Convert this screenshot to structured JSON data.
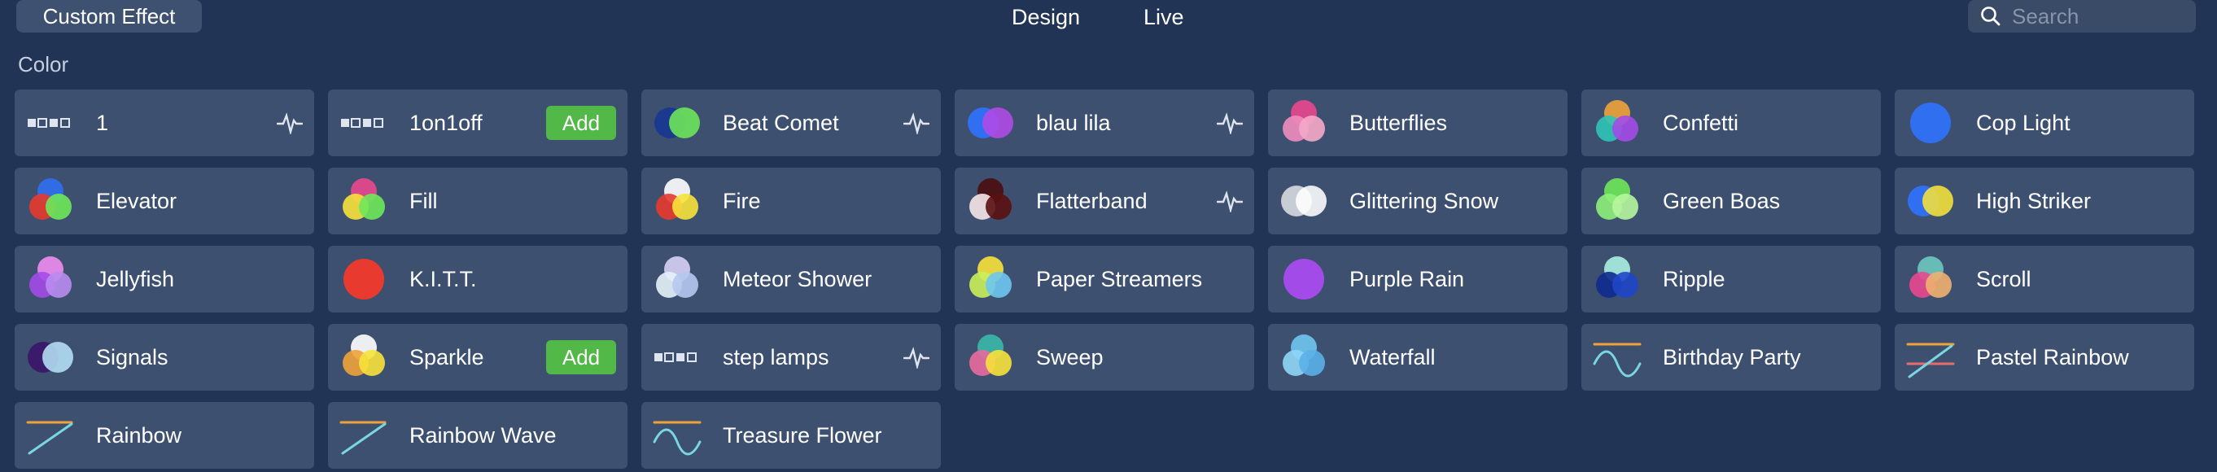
{
  "header": {
    "custom_effect_label": "Custom Effect",
    "tabs": [
      {
        "label": "Design"
      },
      {
        "label": "Live"
      }
    ],
    "search_placeholder": "Search"
  },
  "section_title": "Color",
  "effects": [
    {
      "label": "1",
      "icon": "squares-icon",
      "action": "pulse"
    },
    {
      "label": "1on1off",
      "icon": "squares-icon",
      "action": "add",
      "action_label": "Add"
    },
    {
      "label": "Beat Comet",
      "icon": "two-circles-icon",
      "colors": [
        "#1b3a8f",
        "#6ee85a"
      ],
      "action": "pulse"
    },
    {
      "label": "blau lila",
      "icon": "two-circles-icon",
      "colors": [
        "#2f6ff0",
        "#b44ae8"
      ],
      "action": "pulse"
    },
    {
      "label": "Butterflies",
      "icon": "three-circles-icon",
      "colors": [
        "#e8488e",
        "#f08cbd",
        "#f5a8c8"
      ]
    },
    {
      "label": "Confetti",
      "icon": "three-circles-icon",
      "colors": [
        "#f0a23a",
        "#2ec4b6",
        "#a34be8"
      ]
    },
    {
      "label": "Cop Light",
      "icon": "single-circle-icon",
      "colors": [
        "#2f6ff0"
      ]
    },
    {
      "label": "Elevator",
      "icon": "three-circles-icon",
      "colors": [
        "#2f6ff0",
        "#e83a2e",
        "#6ee85a"
      ]
    },
    {
      "label": "Fill",
      "icon": "three-circles-icon",
      "colors": [
        "#e8488e",
        "#f7e23a",
        "#6ee85a"
      ]
    },
    {
      "label": "Fire",
      "icon": "three-circles-icon",
      "colors": [
        "#ffffff",
        "#e83a2e",
        "#f7e23a"
      ]
    },
    {
      "label": "Flatterband",
      "icon": "three-circles-icon",
      "colors": [
        "#4a0d0d",
        "#f5e6e8",
        "#5a1010"
      ],
      "action": "pulse"
    },
    {
      "label": "Glittering Snow",
      "icon": "two-circles-icon",
      "colors": [
        "#c8ccd4",
        "#ffffff"
      ]
    },
    {
      "label": "Green Boas",
      "icon": "three-circles-icon",
      "colors": [
        "#6ee85a",
        "#8ef07a",
        "#b6f59e"
      ]
    },
    {
      "label": "High Striker",
      "icon": "two-circles-icon",
      "colors": [
        "#2f6ff0",
        "#f7e23a"
      ]
    },
    {
      "label": "Jellyfish",
      "icon": "three-circles-icon",
      "colors": [
        "#f08cf0",
        "#a34be8",
        "#b98cf0"
      ]
    },
    {
      "label": "K.I.T.T.",
      "icon": "single-circle-icon",
      "colors": [
        "#e83a2e"
      ]
    },
    {
      "label": "Meteor Shower",
      "icon": "three-circles-icon",
      "colors": [
        "#d6d0f5",
        "#e6f2fa",
        "#b6c8f0"
      ]
    },
    {
      "label": "Paper Streamers",
      "icon": "three-circles-icon",
      "colors": [
        "#f7e23a",
        "#c8f05a",
        "#6ec6f0"
      ]
    },
    {
      "label": "Purple Rain",
      "icon": "single-circle-icon",
      "colors": [
        "#a34be8"
      ]
    },
    {
      "label": "Ripple",
      "icon": "three-circles-icon",
      "colors": [
        "#a8f0e0",
        "#0f2a8f",
        "#1e46c8"
      ]
    },
    {
      "label": "Scroll",
      "icon": "three-circles-icon",
      "colors": [
        "#6ec6c0",
        "#e8488e",
        "#f0b070"
      ]
    },
    {
      "label": "Signals",
      "icon": "two-circles-icon",
      "colors": [
        "#3a1a6a",
        "#b6e0f5"
      ]
    },
    {
      "label": "Sparkle",
      "icon": "three-circles-icon",
      "colors": [
        "#ffffff",
        "#f0a23a",
        "#f7e23a"
      ],
      "action": "add",
      "action_label": "Add"
    },
    {
      "label": "step lamps",
      "icon": "squares-icon",
      "action": "pulse"
    },
    {
      "label": "Sweep",
      "icon": "three-circles-icon",
      "colors": [
        "#3ab8a8",
        "#e86a9e",
        "#f7e23a"
      ]
    },
    {
      "label": "Waterfall",
      "icon": "three-circles-icon",
      "colors": [
        "#6ec6f0",
        "#8ed6f5",
        "#5ab0e8"
      ]
    },
    {
      "label": "Birthday Party",
      "icon": "wave-line-icon"
    },
    {
      "label": "Pastel Rainbow",
      "icon": "multi-line-icon"
    },
    {
      "label": "Rainbow",
      "icon": "gradient-line-icon"
    },
    {
      "label": "Rainbow Wave",
      "icon": "gradient-line-icon"
    },
    {
      "label": "Treasure Flower",
      "icon": "wave-line-icon"
    }
  ],
  "colors": {
    "background": "#223455",
    "tile": "#3e5070",
    "add_button": "#52b848",
    "line_orange": "#f0a23a",
    "line_teal": "#7ad6e0"
  }
}
